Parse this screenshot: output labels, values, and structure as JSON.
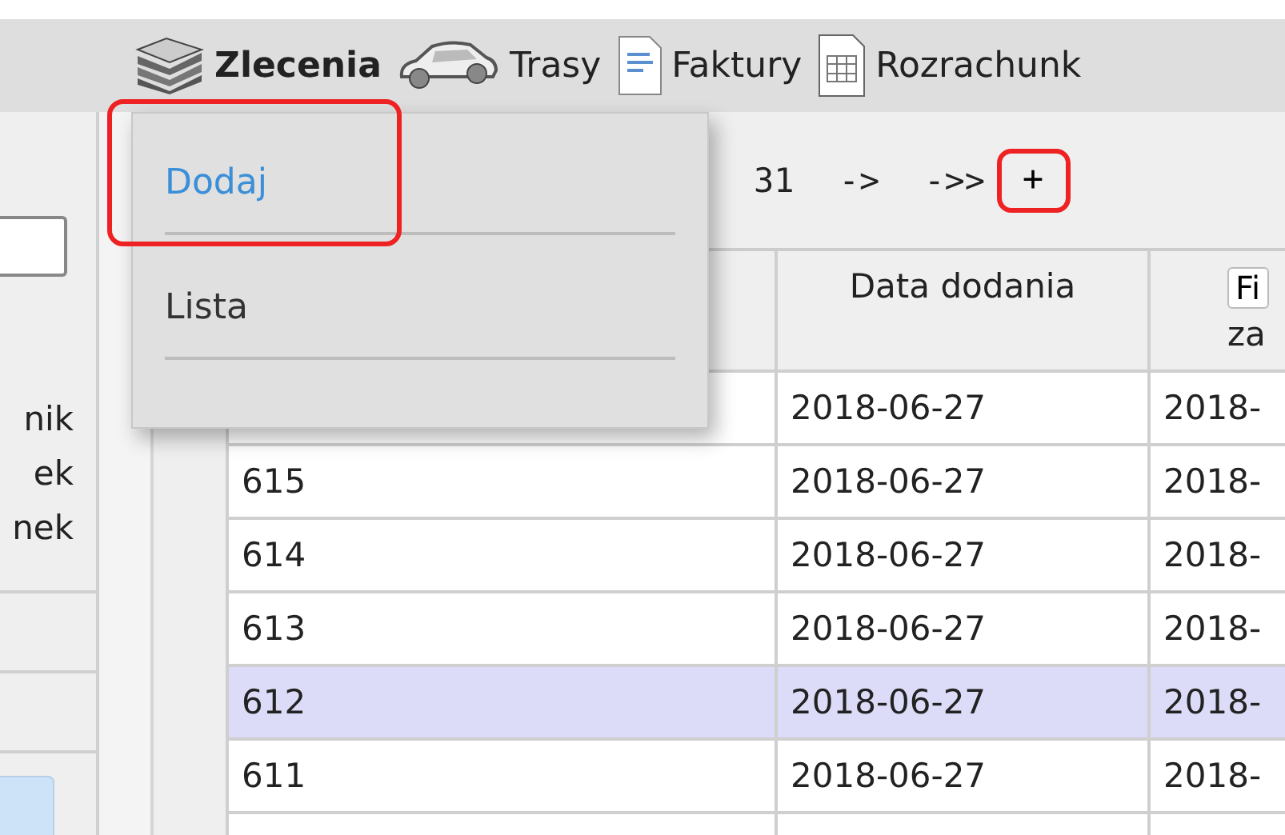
{
  "nav": [
    {
      "label": "Zlecenia",
      "kind": "books",
      "active": true
    },
    {
      "label": "Trasy",
      "kind": "car",
      "active": false
    },
    {
      "label": "Faktury",
      "kind": "document",
      "active": false
    },
    {
      "label": "Rozrachunk",
      "kind": "sheet",
      "active": false
    }
  ],
  "dropdown": {
    "items": [
      {
        "label": "Dodaj",
        "selected": true,
        "highlighted": true
      },
      {
        "label": "Lista",
        "selected": false,
        "highlighted": false
      }
    ]
  },
  "sidebar": {
    "labels": [
      "nik",
      "ek",
      "nek"
    ]
  },
  "pagination": {
    "items": [
      "31",
      "->",
      "->>"
    ],
    "add_button": {
      "label": "+",
      "highlighted": true
    }
  },
  "table": {
    "columns": [
      {},
      {
        "label": "Data dodania"
      },
      {
        "button": "Fi",
        "label": "za"
      }
    ],
    "rows": [
      {
        "cells": [
          null,
          "2018-06-27",
          "2018-"
        ],
        "selected": false
      },
      {
        "cells": [
          "615",
          "2018-06-27",
          "2018-"
        ],
        "selected": false
      },
      {
        "cells": [
          "614",
          "2018-06-27",
          "2018-"
        ],
        "selected": false
      },
      {
        "cells": [
          "613",
          "2018-06-27",
          "2018-"
        ],
        "selected": false
      },
      {
        "cells": [
          "612",
          "2018-06-27",
          "2018-"
        ],
        "selected": true
      },
      {
        "cells": [
          "611",
          "2018-06-27",
          "2018-"
        ],
        "selected": false
      }
    ]
  }
}
